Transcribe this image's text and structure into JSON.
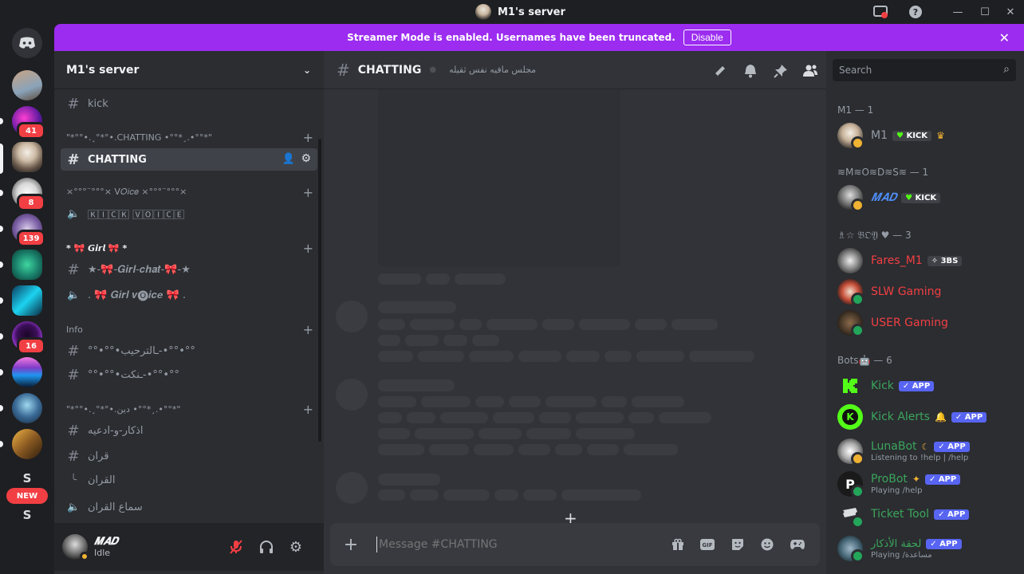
{
  "window": {
    "title": "M1's server"
  },
  "banner": {
    "text": "Streamer Mode is enabled. Usernames have been truncated.",
    "button": "Disable"
  },
  "guild_badges": [
    "41",
    "8",
    "139",
    "16"
  ],
  "guild_letters": [
    "S",
    "S"
  ],
  "new_label": "NEW",
  "server": {
    "name": "M1's server"
  },
  "channels": {
    "kick": "kick",
    "cat_chatting": "\"*°°•.¸°*°•.CHATTING •°°*¸.•°°*\"",
    "chatting": "CHATTING",
    "cat_voice": "×°°°¨°°°× ᐯ𝑂𝑖𝑐𝑒 ×°°°¨°°°×",
    "kick_voice": "🄺🄸🄲🄺 🅅🄾🄸🄲🄴",
    "cat_girl": "* 🎀 𝙂𝙞𝙧𝙡 🎀 *",
    "girl_chat": "★-🎀-𝑮𝒊𝒓𝒍-𝒄𝒉𝒂𝒕-🎀-★",
    "girl_voice": ". 🎀 𝑮𝒊𝒓𝒍 𝒗🅞𝒊𝒄𝒆 🎀 .",
    "cat_info": "Info",
    "welcome": "°°•°°•ـالترحيب-•°°•°°",
    "jokes": "°°•°°•ـنكت-•°°•°°",
    "cat_religion": "\"*°°•.¸°*°•.دين •°°*¸.•°°*\"",
    "adhkar": "اذكار-و-ادعيه",
    "quran": "قران",
    "quran_thread": "القران",
    "quran_voice": "سماع القران"
  },
  "user": {
    "name": "𝑴𝑨𝑫",
    "status": "Idle"
  },
  "chat": {
    "channel": "CHATTING",
    "topic": "مجلس مافيه نفس ثقيله",
    "placeholder": "Message #CHATTING"
  },
  "search": {
    "placeholder": "Search"
  },
  "members": {
    "groups": [
      {
        "title": "M1 — 1"
      },
      {
        "title": "≋M≋O≋D≋S≋ — 1"
      },
      {
        "title": "♗☆ 𝔅𝔒𝔜 ♥︎ — 3"
      },
      {
        "title": "Bots🤖 — 6"
      }
    ],
    "m1": {
      "name": "M1",
      "tag": "KICK"
    },
    "mad": {
      "name": "𝑴𝑨𝑫",
      "tag": "KICK"
    },
    "fares": {
      "name": "Fares_M1",
      "tag": "3BS"
    },
    "slw": {
      "name": "SLW Gaming"
    },
    "usr": {
      "name": "USER Gaming"
    },
    "kick": {
      "name": "Kick",
      "tag": "APP"
    },
    "kick_alerts": {
      "name": "Kick Alerts",
      "tag": "APP"
    },
    "luna": {
      "name": "LunaBot",
      "tag": "APP",
      "sub": "Listening to !help | /help"
    },
    "probot": {
      "name": "ProBot",
      "tag": "APP",
      "sub": "Playing /help"
    },
    "ticket": {
      "name": "Ticket Tool",
      "tag": "APP"
    },
    "halqa": {
      "name": "لحقة الأذكار",
      "tag": "APP",
      "sub": "Playing /مساعدة"
    }
  },
  "colors": {
    "accent": "#9b2cf0",
    "blurple": "#5865f2",
    "role_red": "#f23f43",
    "role_green": "#3ba55c",
    "role_blue": "#4e8df5"
  }
}
